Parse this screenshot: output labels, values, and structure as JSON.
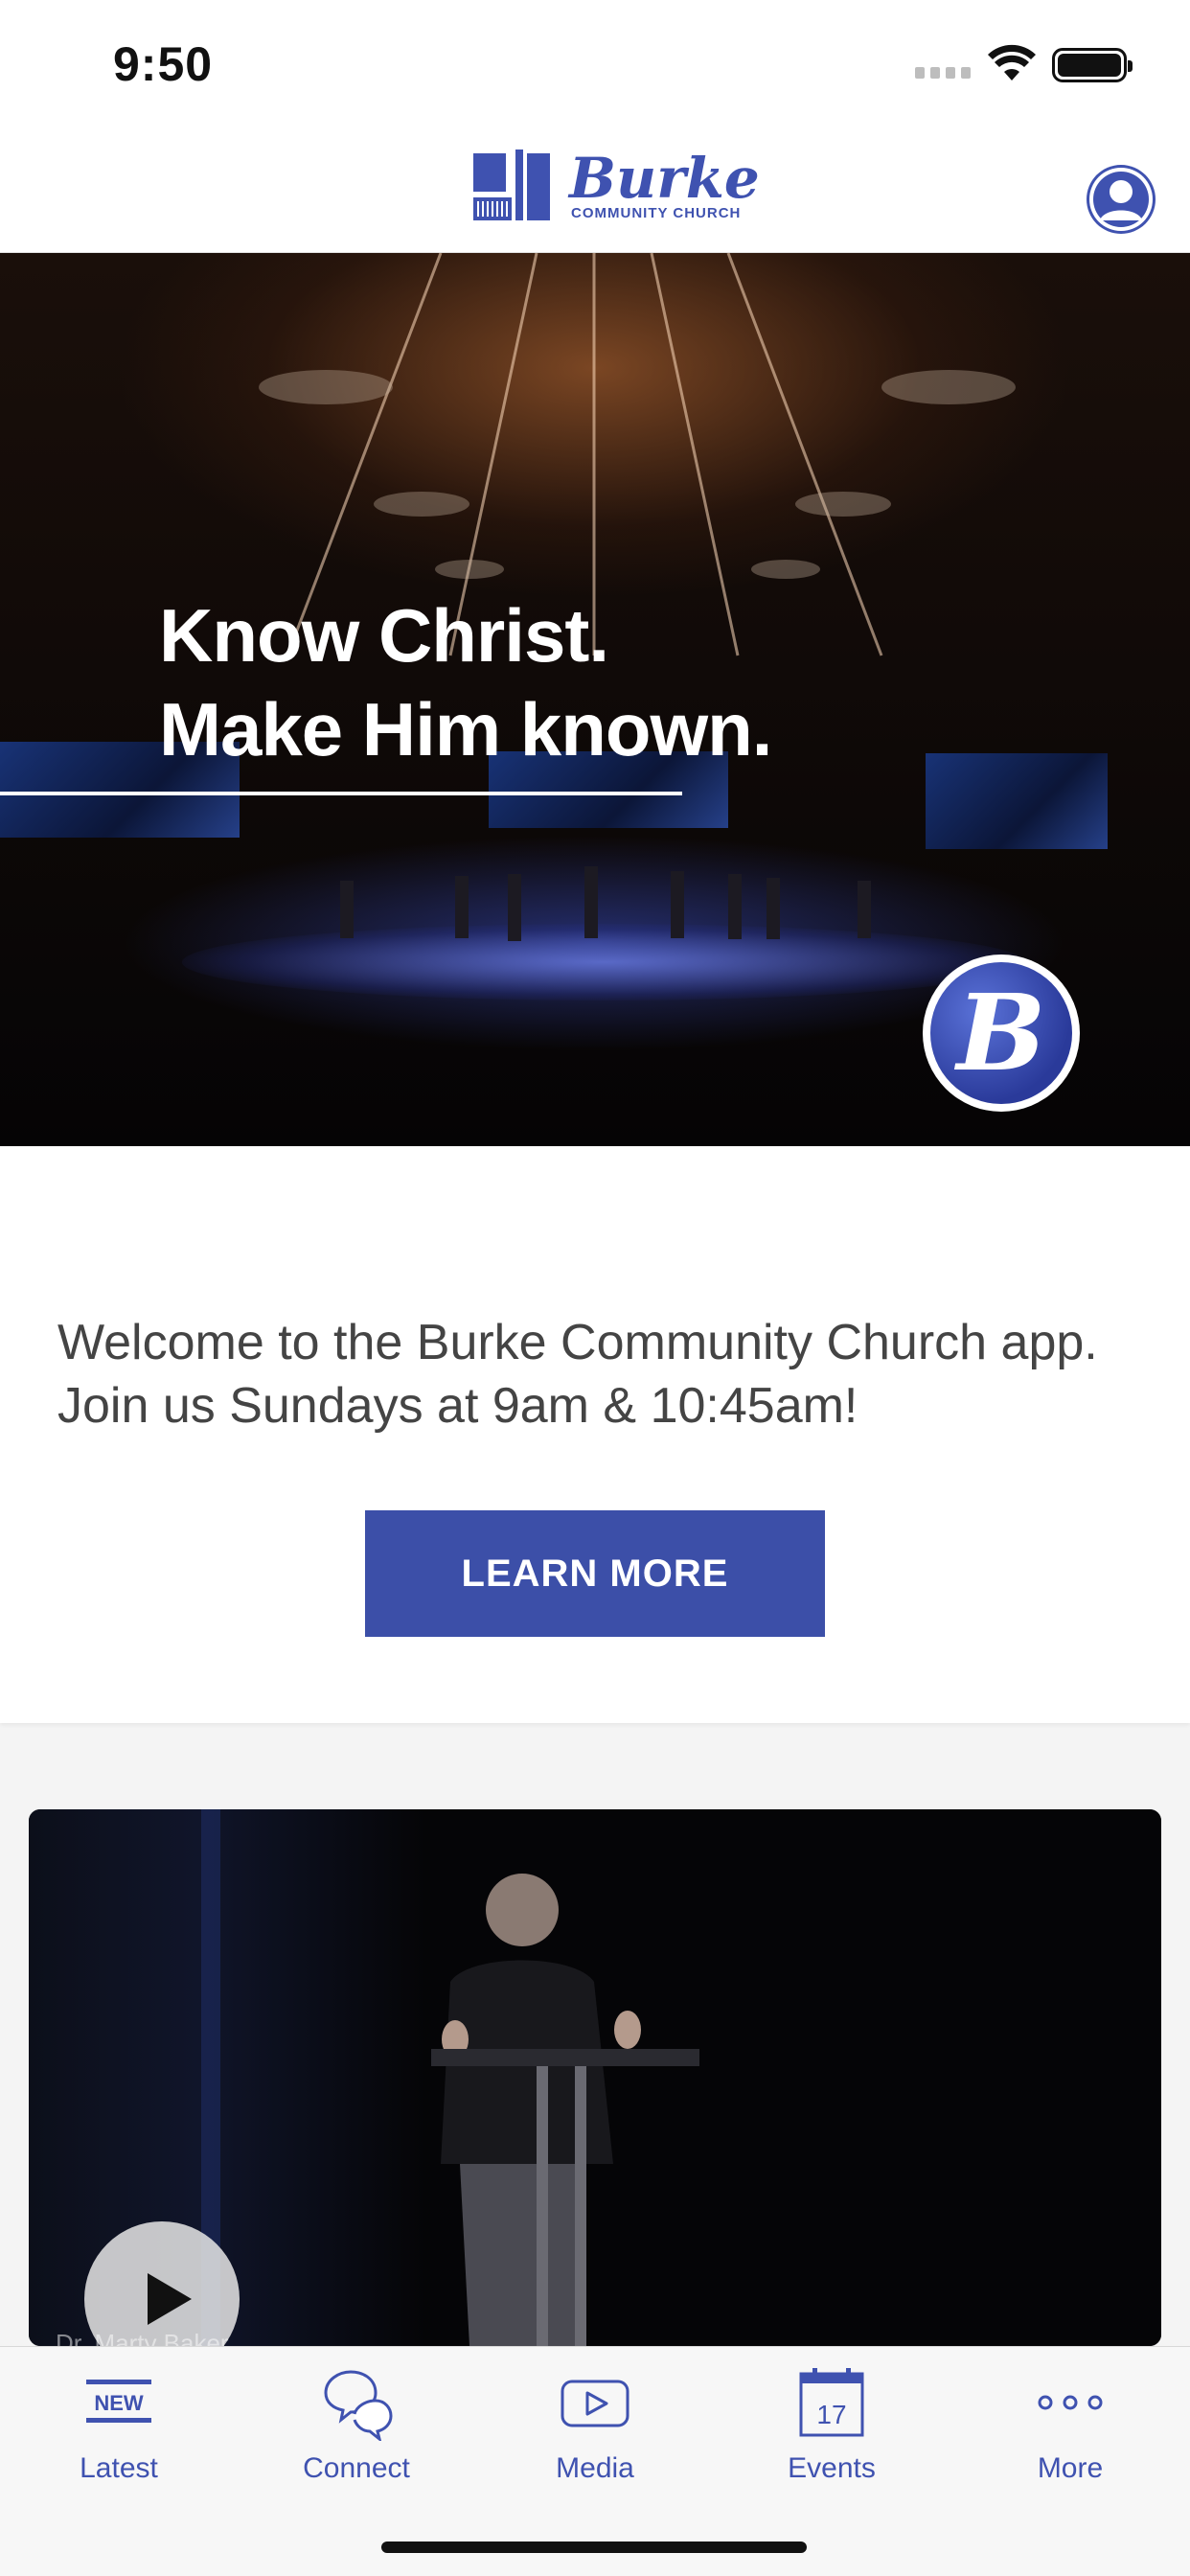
{
  "status_bar": {
    "time": "9:50"
  },
  "header": {
    "logo_name": "Burke",
    "logo_subtitle": "COMMUNITY CHURCH"
  },
  "hero": {
    "title_line1": "Know Christ.",
    "title_line2": "Make Him known.",
    "badge_letter": "B"
  },
  "welcome": {
    "text": "Welcome to the Burke Community Church app. Join us Sundays at 9am & 10:45am!",
    "button_label": "LEARN MORE"
  },
  "video": {
    "caption": "Dr. Marty Baker"
  },
  "tabs": [
    {
      "label": "Latest",
      "icon": "new-icon",
      "badge": "NEW"
    },
    {
      "label": "Connect",
      "icon": "chat-bubbles-icon"
    },
    {
      "label": "Media",
      "icon": "play-screen-icon"
    },
    {
      "label": "Events",
      "icon": "calendar-icon",
      "day": "17"
    },
    {
      "label": "More",
      "icon": "more-dots-icon"
    }
  ],
  "colors": {
    "brand": "#3f52b0",
    "button": "#3c4fa8"
  }
}
